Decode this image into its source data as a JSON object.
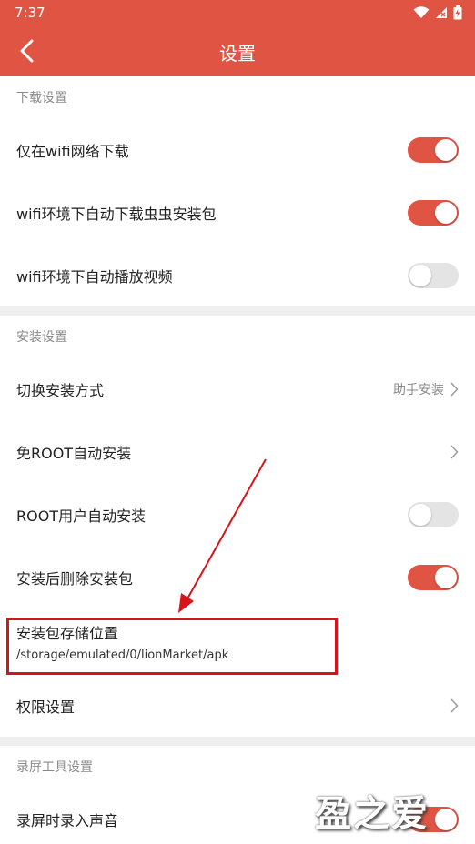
{
  "status_bar": {
    "time": "7:37"
  },
  "toolbar": {
    "title": "设置"
  },
  "sections": {
    "download": {
      "header": "下载设置",
      "items": [
        {
          "label": "仅在wifi网络下载",
          "toggle": "on"
        },
        {
          "label": "wifi环境下自动下载虫虫安装包",
          "toggle": "on"
        },
        {
          "label": "wifi环境下自动播放视频",
          "toggle": "off"
        }
      ]
    },
    "install": {
      "header": "安装设置",
      "switch_method": {
        "label": "切换安装方式",
        "value": "助手安装"
      },
      "root_free": {
        "label": "免ROOT自动安装"
      },
      "root_user": {
        "label": "ROOT用户自动安装",
        "toggle": "off"
      },
      "delete_after": {
        "label": "安装后删除安装包",
        "toggle": "on"
      },
      "storage": {
        "label": "安装包存储位置",
        "path": "/storage/emulated/0/lionMarket/apk"
      },
      "permissions": {
        "label": "权限设置"
      }
    },
    "record": {
      "header": "录屏工具设置",
      "record_audio": {
        "label": "录屏时录入声音",
        "toggle": "on"
      }
    }
  },
  "watermark": "盈之爱",
  "colors": {
    "accent": "#e05444",
    "annotation": "#d8141a"
  },
  "icons": [
    "back-chevron-icon",
    "wifi-icon",
    "signal-icon",
    "battery-icon",
    "chevron-right-icon"
  ]
}
